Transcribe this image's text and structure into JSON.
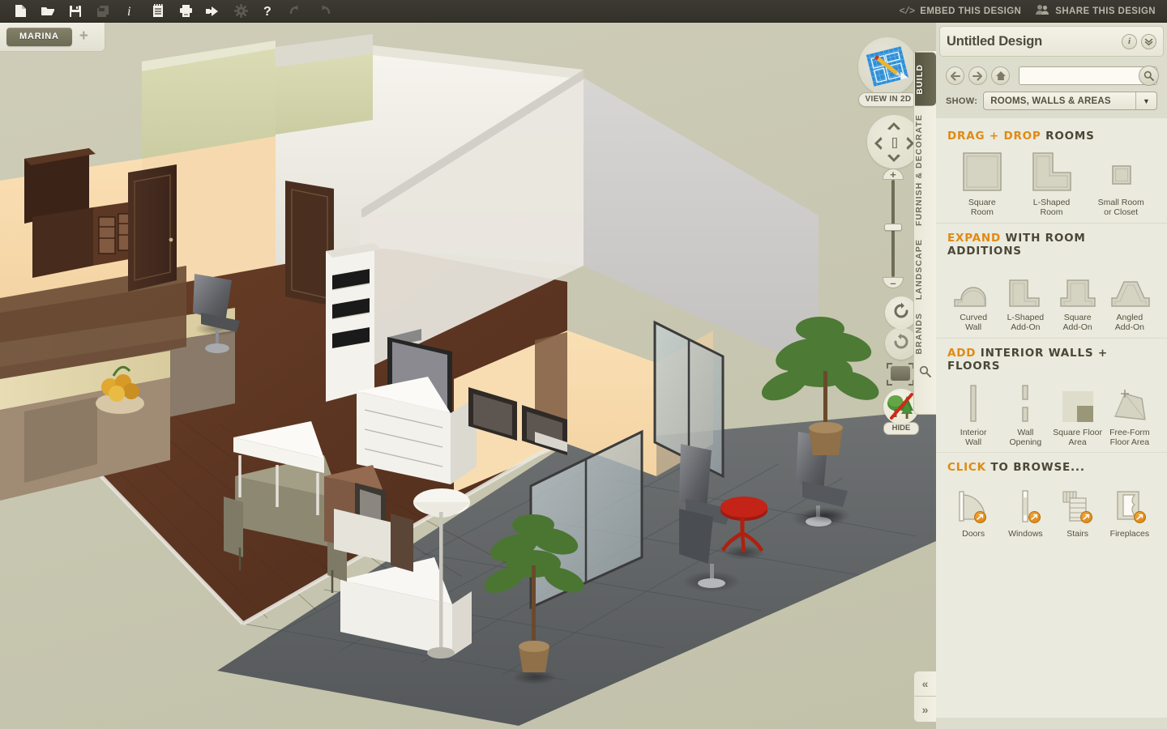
{
  "toolbar": {
    "icons": [
      {
        "name": "new-document-icon",
        "label": "New",
        "dim": false
      },
      {
        "name": "open-folder-icon",
        "label": "Open",
        "dim": false
      },
      {
        "name": "save-icon",
        "label": "Save",
        "dim": false
      },
      {
        "name": "save-as-icon",
        "label": "Save As",
        "dim": true
      },
      {
        "name": "info-icon",
        "label": "Info",
        "dim": false
      },
      {
        "name": "notes-icon",
        "label": "Notes",
        "dim": false
      },
      {
        "name": "print-icon",
        "label": "Print",
        "dim": false
      },
      {
        "name": "export-icon",
        "label": "Export",
        "dim": false
      },
      {
        "name": "gear-icon",
        "label": "Settings",
        "dim": true
      },
      {
        "name": "help-icon",
        "label": "Help",
        "dim": false
      },
      {
        "name": "undo-icon",
        "label": "Undo",
        "dim": true
      },
      {
        "name": "redo-icon",
        "label": "Redo",
        "dim": true
      }
    ],
    "embed_label": "EMBED THIS DESIGN",
    "share_label": "SHARE THIS DESIGN",
    "embed_icon_text": "</>"
  },
  "tabstrip": {
    "active_tab": "MARINA",
    "add_label": "+"
  },
  "viewport": {
    "view_2d_label": "VIEW IN 2D",
    "hide_label": "HIDE",
    "nav_center_glyph": "[ ]",
    "zoom_plus": "+",
    "zoom_minus": "–"
  },
  "vertical_tabs": [
    {
      "label": "BUILD",
      "active": true
    },
    {
      "label": "FURNISH & DECORATE",
      "active": false
    },
    {
      "label": "LANDSCAPE",
      "active": false
    },
    {
      "label": "BRANDS",
      "active": false
    }
  ],
  "panel": {
    "title": "Untitled Design",
    "search_value": "",
    "search_placeholder": "",
    "show_label": "SHOW:",
    "show_value": "ROOMS, WALLS & AREAS",
    "sections": [
      {
        "title_accent": "DRAG + DROP",
        "title_rest": " ROOMS",
        "items": [
          {
            "icon": "square-room-icon",
            "label": "Square\nRoom",
            "line1": "Square",
            "line2": "Room",
            "badge": false
          },
          {
            "icon": "l-shaped-room-icon",
            "label": "L-Shaped Room",
            "line1": "L-Shaped",
            "line2": "Room",
            "badge": false
          },
          {
            "icon": "small-room-icon",
            "label": "Small Room or Closet",
            "line1": "Small Room",
            "line2": "or Closet",
            "badge": false
          }
        ]
      },
      {
        "title_accent": "EXPAND",
        "title_rest": " WITH ROOM ADDITIONS",
        "items": [
          {
            "icon": "curved-wall-icon",
            "line1": "Curved",
            "line2": "Wall",
            "badge": false
          },
          {
            "icon": "l-shaped-addon-icon",
            "line1": "L-Shaped",
            "line2": "Add-On",
            "badge": false
          },
          {
            "icon": "square-addon-icon",
            "line1": "Square",
            "line2": "Add-On",
            "badge": false
          },
          {
            "icon": "angled-addon-icon",
            "line1": "Angled",
            "line2": "Add-On",
            "badge": false
          }
        ]
      },
      {
        "title_accent": "ADD",
        "title_rest": " INTERIOR WALLS + FLOORS",
        "items": [
          {
            "icon": "interior-wall-icon",
            "line1": "Interior",
            "line2": "Wall",
            "badge": false
          },
          {
            "icon": "wall-opening-icon",
            "line1": "Wall",
            "line2": "Opening",
            "badge": false
          },
          {
            "icon": "square-floor-area-icon",
            "line1": "Square Floor",
            "line2": "Area",
            "badge": false
          },
          {
            "icon": "free-form-floor-area-icon",
            "line1": "Free-Form",
            "line2": "Floor Area",
            "badge": false
          }
        ]
      },
      {
        "title_accent": "CLICK",
        "title_rest": " TO BROWSE...",
        "items": [
          {
            "icon": "doors-icon",
            "line1": "Doors",
            "line2": "",
            "badge": true
          },
          {
            "icon": "windows-icon",
            "line1": "Windows",
            "line2": "",
            "badge": true
          },
          {
            "icon": "stairs-icon",
            "line1": "Stairs",
            "line2": "",
            "badge": true
          },
          {
            "icon": "fireplaces-icon",
            "line1": "Fireplaces",
            "line2": "",
            "badge": true
          }
        ]
      }
    ]
  },
  "collapsers": {
    "collapse_label": "«",
    "expand_label": "»"
  },
  "colors": {
    "accent_orange": "#e08a12",
    "toolbar_dark": "#3c3a33",
    "panel_bg": "#eaeade",
    "canvas_bg": "#c9c8b2",
    "tab_olive": "#6e6b55"
  }
}
